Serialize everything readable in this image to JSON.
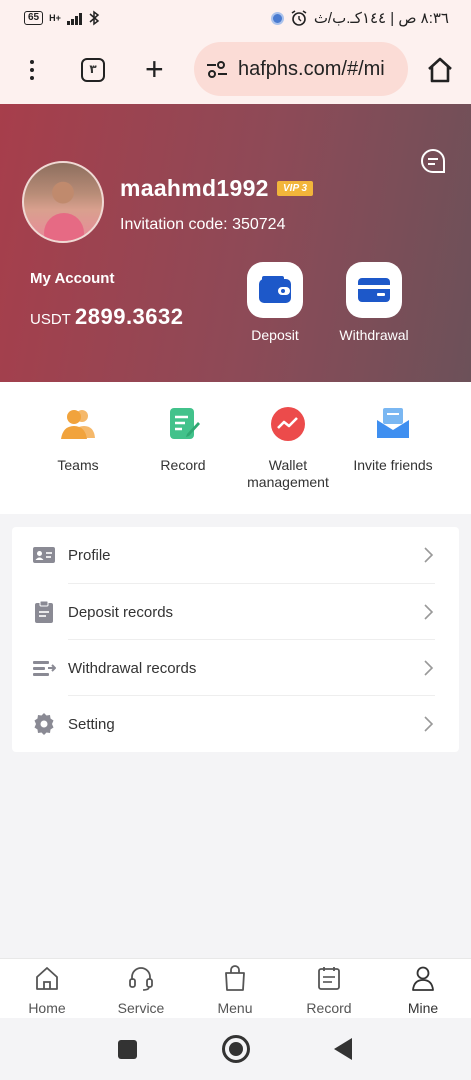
{
  "status_bar": {
    "battery": "65",
    "network": "H+",
    "time": "٨:٣٦ ص | ١٤٤كـ.ب/ث"
  },
  "browser": {
    "tab_count": "٣",
    "url": "hafphs.com/#/mi"
  },
  "profile": {
    "username": "maahmd1992",
    "vip_badge": "VIP 3",
    "invitation_text": "Invitation code: 350724"
  },
  "account": {
    "title": "My Account",
    "currency": "USDT",
    "balance": "2899.3632"
  },
  "actions": {
    "deposit": "Deposit",
    "withdrawal": "Withdrawal"
  },
  "quick_nav": [
    {
      "label": "Teams",
      "icon": "teams-icon"
    },
    {
      "label": "Record",
      "icon": "record-icon"
    },
    {
      "label": "Wallet\nmanagement",
      "icon": "wallet-icon"
    },
    {
      "label": "Invite friends",
      "icon": "invite-icon"
    }
  ],
  "menu": [
    {
      "label": "Profile",
      "icon": "profile-card-icon"
    },
    {
      "label": "Deposit records",
      "icon": "clipboard-icon"
    },
    {
      "label": "Withdrawal records",
      "icon": "withdraw-list-icon"
    },
    {
      "label": "Setting",
      "icon": "gear-icon"
    }
  ],
  "bottom_nav": [
    {
      "label": "Home",
      "icon": "home-icon"
    },
    {
      "label": "Service",
      "icon": "headset-icon"
    },
    {
      "label": "Menu",
      "icon": "bag-icon"
    },
    {
      "label": "Record",
      "icon": "calendar-icon"
    },
    {
      "label": "Mine",
      "icon": "user-icon"
    }
  ],
  "colors": {
    "header_gradient_start": "#a73e4b",
    "header_gradient_end": "#6c5159",
    "vip_gold": "#f2b53a",
    "deposit_blue": "#1d58c9"
  }
}
